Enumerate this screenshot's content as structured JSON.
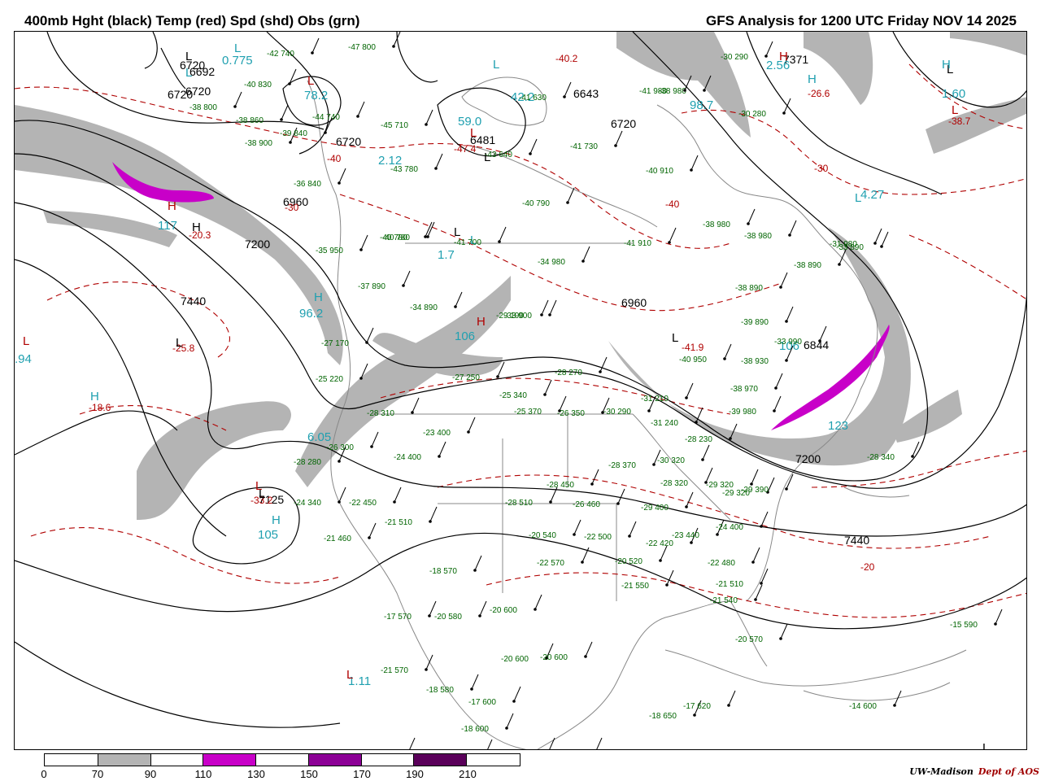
{
  "header": {
    "left_title": "400mb Hght (black) Temp (red) Spd (shd) Obs (grn)",
    "right_title": "GFS Analysis for 1200 UTC Friday  NOV 14 2025"
  },
  "colors": {
    "height": "#000000",
    "temp": "#b00000",
    "obs": "#006400",
    "speed_label": "#20a0b0",
    "land": "#888888",
    "speed_70": "#b4b4b4",
    "speed_110": "#c800c8",
    "speed_150": "#8c0096",
    "speed_190": "#5a005a"
  },
  "colorbar": {
    "labels": [
      "0",
      "70",
      "90",
      "110",
      "130",
      "150",
      "170",
      "190",
      "210"
    ],
    "segments": [
      {
        "color": "#ffffff"
      },
      {
        "color": "#b4b4b4"
      },
      {
        "color": "#ffffff"
      },
      {
        "color": "#c800c8"
      },
      {
        "color": "#ffffff"
      },
      {
        "color": "#8c0096"
      },
      {
        "color": "#ffffff"
      },
      {
        "color": "#5a005a"
      },
      {
        "color": "#ffffff"
      }
    ]
  },
  "credit": {
    "org": "UW-Madison",
    "dept": "Dept of AOS"
  },
  "height_labels": [
    "6720",
    "6692",
    "6720",
    "6720",
    "6720",
    "6643",
    "6720",
    "6481",
    "6960",
    "7200",
    "7440",
    "6960",
    "6844",
    "7200",
    "7440",
    "7371",
    "7125"
  ],
  "temp_labels": [
    "-40",
    "-30",
    "-20.3",
    "-25.8",
    "-18.6",
    "-33.2",
    "-47.4",
    "-40.2",
    "-26.6",
    "-38.7",
    "-30",
    "-40",
    "-41.9",
    "-20",
    "-20"
  ],
  "speed_labels": [
    "0.775",
    "78.2",
    "59.0",
    "42.2",
    "117",
    "96.2",
    "106",
    "6.05",
    "105",
    "1.11",
    "2.56",
    "98.7",
    "1.60",
    "4.27",
    "106",
    "123",
    "1.7",
    ".94",
    "2.12"
  ],
  "highs_lows": [
    "L",
    "L",
    "L",
    "L",
    "H",
    "H",
    "L",
    "L",
    "L",
    "H",
    "L",
    "L",
    "H",
    "L",
    "L",
    "H",
    "L",
    "L",
    "H",
    "H",
    "L",
    "L",
    "H",
    "L",
    "L",
    "L",
    "L",
    "H"
  ],
  "obs_labels": [
    "-42 740",
    "-47 800",
    "-40 830",
    "-38 800",
    "-38 860",
    "-38 900",
    "-44 740",
    "-39 840",
    "-45 710",
    "-43 780",
    "-36 840",
    "-40 780",
    "-41 630",
    "-43 640",
    "-41 730",
    "-38 980",
    "-30 290",
    "-30 280",
    "-40 910",
    "-40 790",
    "-40 780",
    "-41 700",
    "-41 910",
    "-34 980",
    "-38 980",
    "-35 950",
    "-37 890",
    "-34 890",
    "-33 900",
    "-27 170",
    "-25 220",
    "-28 310",
    "-26 300",
    "-28 280",
    "-24 340",
    "-22 450",
    "-21 510",
    "-21 460",
    "-24 400",
    "-23 400",
    "-25 340",
    "-25 370",
    "-26 350",
    "-30 290",
    "-28 270",
    "-27 250",
    "-31 210",
    "-31 240",
    "-28 230",
    "-30 320",
    "-28 370",
    "-28 320",
    "-29 320",
    "-29 320",
    "-28 450",
    "-26 460",
    "-28 510",
    "-29 400",
    "-20 540",
    "-22 500",
    "-22 420",
    "-23 440",
    "-24 400",
    "-18 570",
    "-22 570",
    "-20 520",
    "-21 550",
    "-22 480",
    "-21 510",
    "-21 540",
    "-20 570",
    "-17 570",
    "-20 580",
    "-20 600",
    "-20 600",
    "-20 600",
    "-21 570",
    "-18 580",
    "-17 600",
    "-18 600",
    "-17 620",
    "-18 650",
    "-17 620",
    "-18 580",
    "-18 610",
    "-20",
    "-15 590",
    "-14 600",
    "-40 950",
    "-38 890",
    "-38 930",
    "-38 970",
    "-39 980",
    "-39 890",
    "-38 890",
    "-33 890",
    "-38 980",
    "-28 340",
    "-29 190",
    "-29 390",
    "-33 990",
    "-31 980",
    "-41 980"
  ]
}
